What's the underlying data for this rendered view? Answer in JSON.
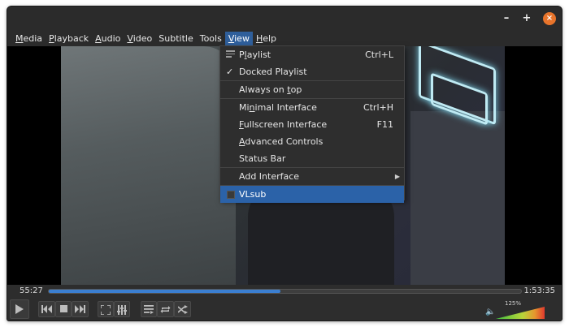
{
  "titlebar": {
    "minimize_glyph": "–",
    "maximize_glyph": "+",
    "close_glyph": "×"
  },
  "menubar": {
    "items": [
      {
        "label": "Media",
        "u": "M",
        "rest": "edia"
      },
      {
        "label": "Playback",
        "u": "P",
        "rest": "layback"
      },
      {
        "label": "Audio",
        "u": "A",
        "rest": "udio"
      },
      {
        "label": "Video",
        "u": "V",
        "rest": "ideo"
      },
      {
        "label": "Subtitle",
        "u": "",
        "rest": "Subtitle"
      },
      {
        "label": "Tools",
        "u": "",
        "rest": "Tools"
      },
      {
        "label": "View",
        "u": "V",
        "rest": "iew",
        "active": true
      },
      {
        "label": "Help",
        "u": "H",
        "rest": "elp"
      }
    ]
  },
  "view_menu": {
    "playlist": {
      "label_pre": "P",
      "label_u": "l",
      "label_post": "aylist",
      "shortcut": "Ctrl+L",
      "icon": "playlist-icon"
    },
    "docked_playlist": {
      "label": "Docked Playlist",
      "checked": true,
      "check_glyph": "✓"
    },
    "always_on_top": {
      "label_pre": "Always on ",
      "label_u": "t",
      "label_post": "op"
    },
    "minimal_interface": {
      "label_pre": "Mi",
      "label_u": "n",
      "label_post": "imal Interface",
      "shortcut": "Ctrl+H"
    },
    "fullscreen_interface": {
      "label_pre": "",
      "label_u": "F",
      "label_post": "ullscreen Interface",
      "shortcut": "F11"
    },
    "advanced_controls": {
      "label_pre": "",
      "label_u": "A",
      "label_post": "dvanced Controls"
    },
    "status_bar": {
      "label": "Status Bar"
    },
    "add_interface": {
      "label": "Add Interface",
      "arrow": "▶"
    },
    "vlsub": {
      "label": "VLsub"
    }
  },
  "playback": {
    "elapsed": "55:27",
    "total": "1:53:35",
    "progress_fraction": 0.49
  },
  "volume": {
    "percent_label": "125%",
    "level_fraction": 1.0,
    "icon": "speaker-icon"
  },
  "colors": {
    "accent": "#2b62a8",
    "seek_fill": "#3b7fd1",
    "close_button": "#e8742b"
  }
}
